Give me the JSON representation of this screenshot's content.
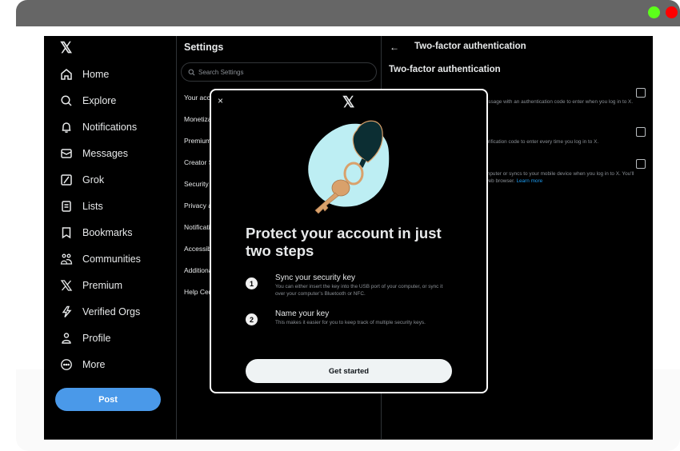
{
  "window": {
    "controls": [
      {
        "name": "maximize",
        "color": "#5cff1a"
      },
      {
        "name": "close",
        "color": "#ff0000"
      }
    ]
  },
  "nav": {
    "logo": "𝕏",
    "items": [
      {
        "label": "Home",
        "icon": "home-icon"
      },
      {
        "label": "Explore",
        "icon": "search-icon"
      },
      {
        "label": "Notifications",
        "icon": "bell-icon"
      },
      {
        "label": "Messages",
        "icon": "envelope-icon"
      },
      {
        "label": "Grok",
        "icon": "grok-icon"
      },
      {
        "label": "Lists",
        "icon": "list-icon"
      },
      {
        "label": "Bookmarks",
        "icon": "bookmark-icon"
      },
      {
        "label": "Communities",
        "icon": "communities-icon"
      },
      {
        "label": "Premium",
        "icon": "x-logo-icon"
      },
      {
        "label": "Verified Orgs",
        "icon": "lightning-icon"
      },
      {
        "label": "Profile",
        "icon": "person-icon"
      },
      {
        "label": "More",
        "icon": "more-circle-icon"
      }
    ],
    "post_label": "Post",
    "post_color": "#4a99e9"
  },
  "settings": {
    "title": "Settings",
    "search_placeholder": "Search Settings",
    "items": [
      "Your account",
      "Monetization",
      "Premium",
      "Creator Subscriptions",
      "Security and account access",
      "Privacy and safety",
      "Notifications",
      "Accessibility, display, and languages",
      "Additional resources",
      "Help Center"
    ]
  },
  "tfa": {
    "back": "←",
    "header": "Two-factor authentication",
    "subheader": "Two-factor authentication",
    "options": [
      {
        "desc": "Use your mobile phone to receive a text message with an authentication code to enter when you log in to X.",
        "checked": false
      },
      {
        "desc": "Use a mobile authentication app to get a verification code to enter every time you log in to X.",
        "checked": false
      },
      {
        "desc": "Use a security key that inserts into your computer or syncs to your mobile device when you log in to X. You'll need to use a supported mobile device or web browser.",
        "link": "Learn more",
        "checked": false
      }
    ]
  },
  "modal": {
    "close": "×",
    "logo": "𝕏",
    "illustration": "heart-keychain-with-key",
    "headline": "Protect your account in just two steps",
    "steps": [
      {
        "num": "1",
        "title": "Sync your security key",
        "desc": "You can either insert the key into the USB port of your computer, or sync it over your computer’s Bluetooth or NFC."
      },
      {
        "num": "2",
        "title": "Name your key",
        "desc": "This makes it easier for you to keep track of multiple security keys."
      }
    ],
    "cta": "Get started"
  }
}
